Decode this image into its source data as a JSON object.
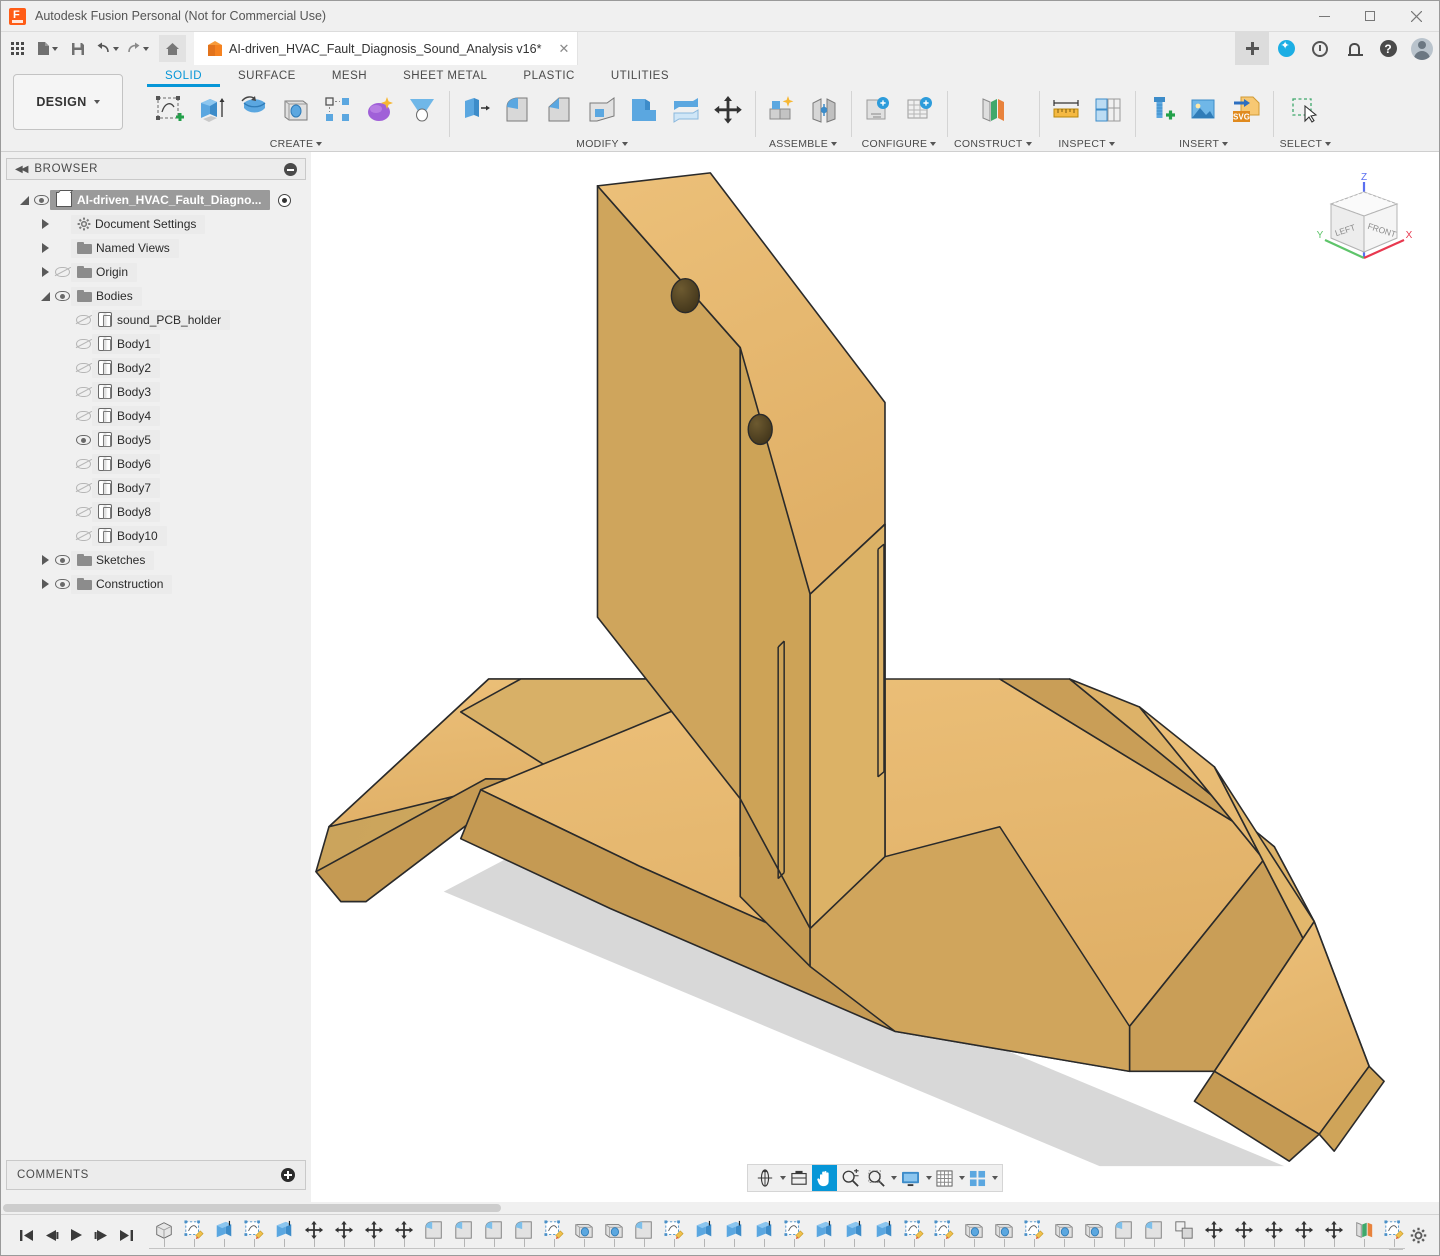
{
  "window": {
    "app_title": "Autodesk Fusion Personal (Not for Commercial Use)",
    "logo_name": "fusion-logo",
    "minimize": "—",
    "maximize": "☐",
    "close": "✕"
  },
  "quick_access": {
    "items": [
      {
        "name": "app-grid-button",
        "label": "Apps"
      },
      {
        "name": "new-file-button",
        "label": "New"
      },
      {
        "name": "save-button",
        "label": "Save"
      },
      {
        "name": "undo-button",
        "label": "Undo"
      },
      {
        "name": "redo-button",
        "label": "Redo"
      },
      {
        "name": "home-button",
        "label": "Home"
      }
    ]
  },
  "document_tab": {
    "title": "AI-driven_HVAC_Fault_Diagnosis_Sound_Analysis v16*",
    "close_label": "✕",
    "add_tab_label": "+"
  },
  "tab_right_icons": [
    {
      "name": "extensions-icon",
      "label": "Extensions"
    },
    {
      "name": "history-clock-icon",
      "label": "Recent"
    },
    {
      "name": "notifications-bell-icon",
      "label": "Notifications"
    },
    {
      "name": "help-question-icon",
      "label": "Help"
    },
    {
      "name": "user-avatar",
      "label": "Account"
    }
  ],
  "ribbon": {
    "workspace_button": "DESIGN",
    "tabs": [
      {
        "label": "SOLID",
        "active": true
      },
      {
        "label": "SURFACE",
        "active": false
      },
      {
        "label": "MESH",
        "active": false
      },
      {
        "label": "SHEET METAL",
        "active": false
      },
      {
        "label": "PLASTIC",
        "active": false
      },
      {
        "label": "UTILITIES",
        "active": false
      }
    ],
    "panels": [
      {
        "title": "CREATE",
        "has_dropdown": true,
        "tools": [
          "create-sketch-icon",
          "extrude-icon",
          "revolve-icon",
          "hole-icon",
          "rectangular-pattern-icon",
          "form-icon",
          "loft-icon"
        ]
      },
      {
        "title": "MODIFY",
        "has_dropdown": true,
        "tools": [
          "press-pull-icon",
          "fillet-icon",
          "chamfer-icon",
          "shell-icon",
          "combine-icon",
          "split-face-icon",
          "move-copy-icon"
        ]
      },
      {
        "title": "ASSEMBLE",
        "has_dropdown": true,
        "tools": [
          "new-component-icon",
          "joint-icon"
        ]
      },
      {
        "title": "CONFIGURE",
        "has_dropdown": true,
        "tools": [
          "configure-design-icon",
          "configuration-table-icon"
        ]
      },
      {
        "title": "CONSTRUCT",
        "has_dropdown": true,
        "tools": [
          "offset-plane-icon"
        ]
      },
      {
        "title": "INSPECT",
        "has_dropdown": true,
        "tools": [
          "measure-icon",
          "section-analysis-icon"
        ]
      },
      {
        "title": "INSERT",
        "has_dropdown": true,
        "tools": [
          "insert-mcmaster-icon",
          "insert-image-icon",
          "insert-svg-icon"
        ]
      },
      {
        "title": "SELECT",
        "has_dropdown": true,
        "tools": [
          "select-window-icon"
        ]
      }
    ]
  },
  "browser": {
    "header": "BROWSER",
    "collapse_label": "◀◀",
    "tree": [
      {
        "label": "AI-driven_HVAC_Fault_Diagno...",
        "depth": 0,
        "twisty": "open",
        "visible": true,
        "icon": "component-icon",
        "selected": true,
        "activate_dot": true
      },
      {
        "label": "Document Settings",
        "depth": 1,
        "twisty": "closed",
        "visible": null,
        "icon": "gear-icon",
        "selected": false
      },
      {
        "label": "Named Views",
        "depth": 1,
        "twisty": "closed",
        "visible": null,
        "icon": "folder-icon",
        "selected": false
      },
      {
        "label": "Origin",
        "depth": 1,
        "twisty": "closed",
        "visible": false,
        "icon": "folder-icon",
        "selected": false
      },
      {
        "label": "Bodies",
        "depth": 1,
        "twisty": "open",
        "visible": true,
        "icon": "folder-icon",
        "selected": false
      },
      {
        "label": "sound_PCB_holder",
        "depth": 2,
        "twisty": "none",
        "visible": false,
        "icon": "body-icon",
        "selected": false
      },
      {
        "label": "Body1",
        "depth": 2,
        "twisty": "none",
        "visible": false,
        "icon": "body-icon",
        "selected": false
      },
      {
        "label": "Body2",
        "depth": 2,
        "twisty": "none",
        "visible": false,
        "icon": "body-icon",
        "selected": false
      },
      {
        "label": "Body3",
        "depth": 2,
        "twisty": "none",
        "visible": false,
        "icon": "body-icon",
        "selected": false
      },
      {
        "label": "Body4",
        "depth": 2,
        "twisty": "none",
        "visible": false,
        "icon": "body-icon",
        "selected": false
      },
      {
        "label": "Body5",
        "depth": 2,
        "twisty": "none",
        "visible": true,
        "icon": "body-icon",
        "selected": false
      },
      {
        "label": "Body6",
        "depth": 2,
        "twisty": "none",
        "visible": false,
        "icon": "body-icon",
        "selected": false
      },
      {
        "label": "Body7",
        "depth": 2,
        "twisty": "none",
        "visible": false,
        "icon": "body-icon",
        "selected": false
      },
      {
        "label": "Body8",
        "depth": 2,
        "twisty": "none",
        "visible": false,
        "icon": "body-icon",
        "selected": false
      },
      {
        "label": "Body10",
        "depth": 2,
        "twisty": "none",
        "visible": false,
        "icon": "body-icon",
        "selected": false
      },
      {
        "label": "Sketches",
        "depth": 1,
        "twisty": "closed",
        "visible": true,
        "icon": "folder-icon",
        "selected": false
      },
      {
        "label": "Construction",
        "depth": 1,
        "twisty": "closed",
        "visible": true,
        "icon": "folder-icon",
        "selected": false
      }
    ]
  },
  "comments": {
    "header": "COMMENTS",
    "add_label": "+"
  },
  "viewcube": {
    "face_left": "LEFT",
    "face_front": "FRONT",
    "axis_x": "X",
    "axis_y": "Y",
    "axis_z": "Z",
    "color_x": "#e8384f",
    "color_y": "#5ec46a",
    "color_z": "#5a6ff0"
  },
  "nav_bar": {
    "items": [
      {
        "name": "orbit-icon",
        "label": "Orbit",
        "dropdown": true,
        "active": false
      },
      {
        "name": "look-at-icon",
        "label": "Look At",
        "dropdown": false,
        "active": false
      },
      {
        "name": "pan-hand-icon",
        "label": "Pan",
        "dropdown": false,
        "active": true
      },
      {
        "name": "zoom-icon",
        "label": "Zoom",
        "dropdown": false,
        "active": false
      },
      {
        "name": "fit-icon",
        "label": "Fit",
        "dropdown": true,
        "active": false
      },
      {
        "name": "display-settings-icon",
        "label": "Display Settings",
        "dropdown": true,
        "active": false
      },
      {
        "name": "grid-snaps-icon",
        "label": "Grid and Snaps",
        "dropdown": true,
        "active": false
      },
      {
        "name": "viewports-icon",
        "label": "Viewports",
        "dropdown": true,
        "active": false
      }
    ]
  },
  "timeline": {
    "playback": [
      "go-to-beginning-icon",
      "step-back-icon",
      "play-icon",
      "step-forward-icon",
      "go-to-end-icon"
    ],
    "features": [
      "component-feature",
      "sketch-feature",
      "extrude-feature",
      "sketch-feature",
      "extrude-feature",
      "move-feature",
      "move-feature",
      "move-feature",
      "move-feature",
      "fillet-feature",
      "fillet-feature",
      "fillet-feature",
      "fillet-feature",
      "sketch-feature",
      "hole-feature",
      "hole-feature",
      "fillet-feature",
      "sketch-feature",
      "extrude-feature",
      "extrude-feature",
      "extrude-feature",
      "sketch-feature",
      "extrude-feature",
      "extrude-feature",
      "extrude-feature",
      "sketch-feature",
      "sketch-feature",
      "hole-feature",
      "hole-feature",
      "sketch-feature",
      "hole-feature",
      "hole-feature",
      "fillet-feature",
      "fillet-feature",
      "combine-feature",
      "move-feature",
      "move-feature",
      "move-feature",
      "move-feature",
      "move-feature",
      "plane-feature",
      "sketch-feature",
      "extrude-feature",
      "move-feature",
      "fillet-feature",
      "fillet-feature",
      "fillet-feature",
      "fillet-feature",
      "sketch-feature",
      "extrude-feature",
      "sketch-feature",
      "sketch-feature"
    ],
    "settings_label": "Timeline Settings"
  },
  "model": {
    "body_color_light": "#e8b96a",
    "body_color_mid": "#d9ab5e",
    "body_color_dark": "#c6a056",
    "body_color_darker": "#b9924b",
    "edge_color": "#2a2a2a",
    "shadow_color": "#d6d6d6",
    "background": "#ffffff"
  }
}
